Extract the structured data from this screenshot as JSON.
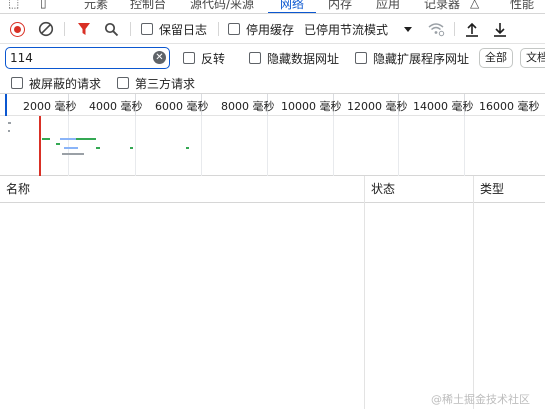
{
  "tabs": [
    {
      "label": "元素"
    },
    {
      "label": "控制台"
    },
    {
      "label": "源代码/来源"
    },
    {
      "label": "网络",
      "active": true
    },
    {
      "label": "内存"
    },
    {
      "label": "应用"
    },
    {
      "label": "记录器"
    },
    {
      "label": "性能"
    }
  ],
  "toolbar": {
    "preserve_log": "保留日志",
    "disable_cache": "停用缓存",
    "throttle": "已停用节流模式"
  },
  "filter": {
    "value": "114",
    "invert": "反转",
    "hide_data_urls": "隐藏数据网址",
    "hide_extension_urls": "隐藏扩展程序网址",
    "all": "全部",
    "doc": "文档",
    "blocked_requests": "被屏蔽的请求",
    "third_party": "第三方请求"
  },
  "timeline": {
    "ticks": [
      "2000 毫秒",
      "4000 毫秒",
      "6000 毫秒",
      "8000 毫秒",
      "10000 毫秒",
      "12000 毫秒",
      "14000 毫秒",
      "16000 毫秒"
    ]
  },
  "table": {
    "columns": [
      "名称",
      "状态",
      "类型"
    ]
  },
  "watermark": "@稀土掘金技术社区",
  "colors": {
    "accent": "#0b57d0",
    "record": "#d93025",
    "bar_green": "#34a853",
    "bar_blue": "#8ab4f8",
    "bar_gray": "#9aa0a6"
  }
}
